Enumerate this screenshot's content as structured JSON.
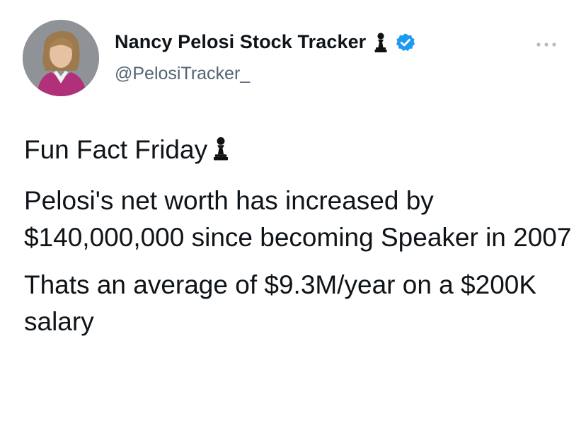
{
  "tweet": {
    "author": {
      "display_name": "Nancy Pelosi Stock Tracker",
      "handle": "@PelosiTracker_",
      "name_icons": [
        "chess-pawn-icon",
        "verified-badge-icon"
      ]
    },
    "more_icon": "more-options-icon",
    "paragraphs": [
      {
        "text": "Fun Fact Friday",
        "icon": "chess-pawn-icon"
      },
      {
        "text": "Pelosi's net worth has increased by $140,000,000 since becoming Speaker in 2007"
      },
      {
        "text": "Thats an average of $9.3M/year on a $200K salary"
      }
    ]
  },
  "colors": {
    "text": "#0f1419",
    "secondary_text": "#536471",
    "verified_blue": "#1d9bf0",
    "background": "#ffffff"
  }
}
